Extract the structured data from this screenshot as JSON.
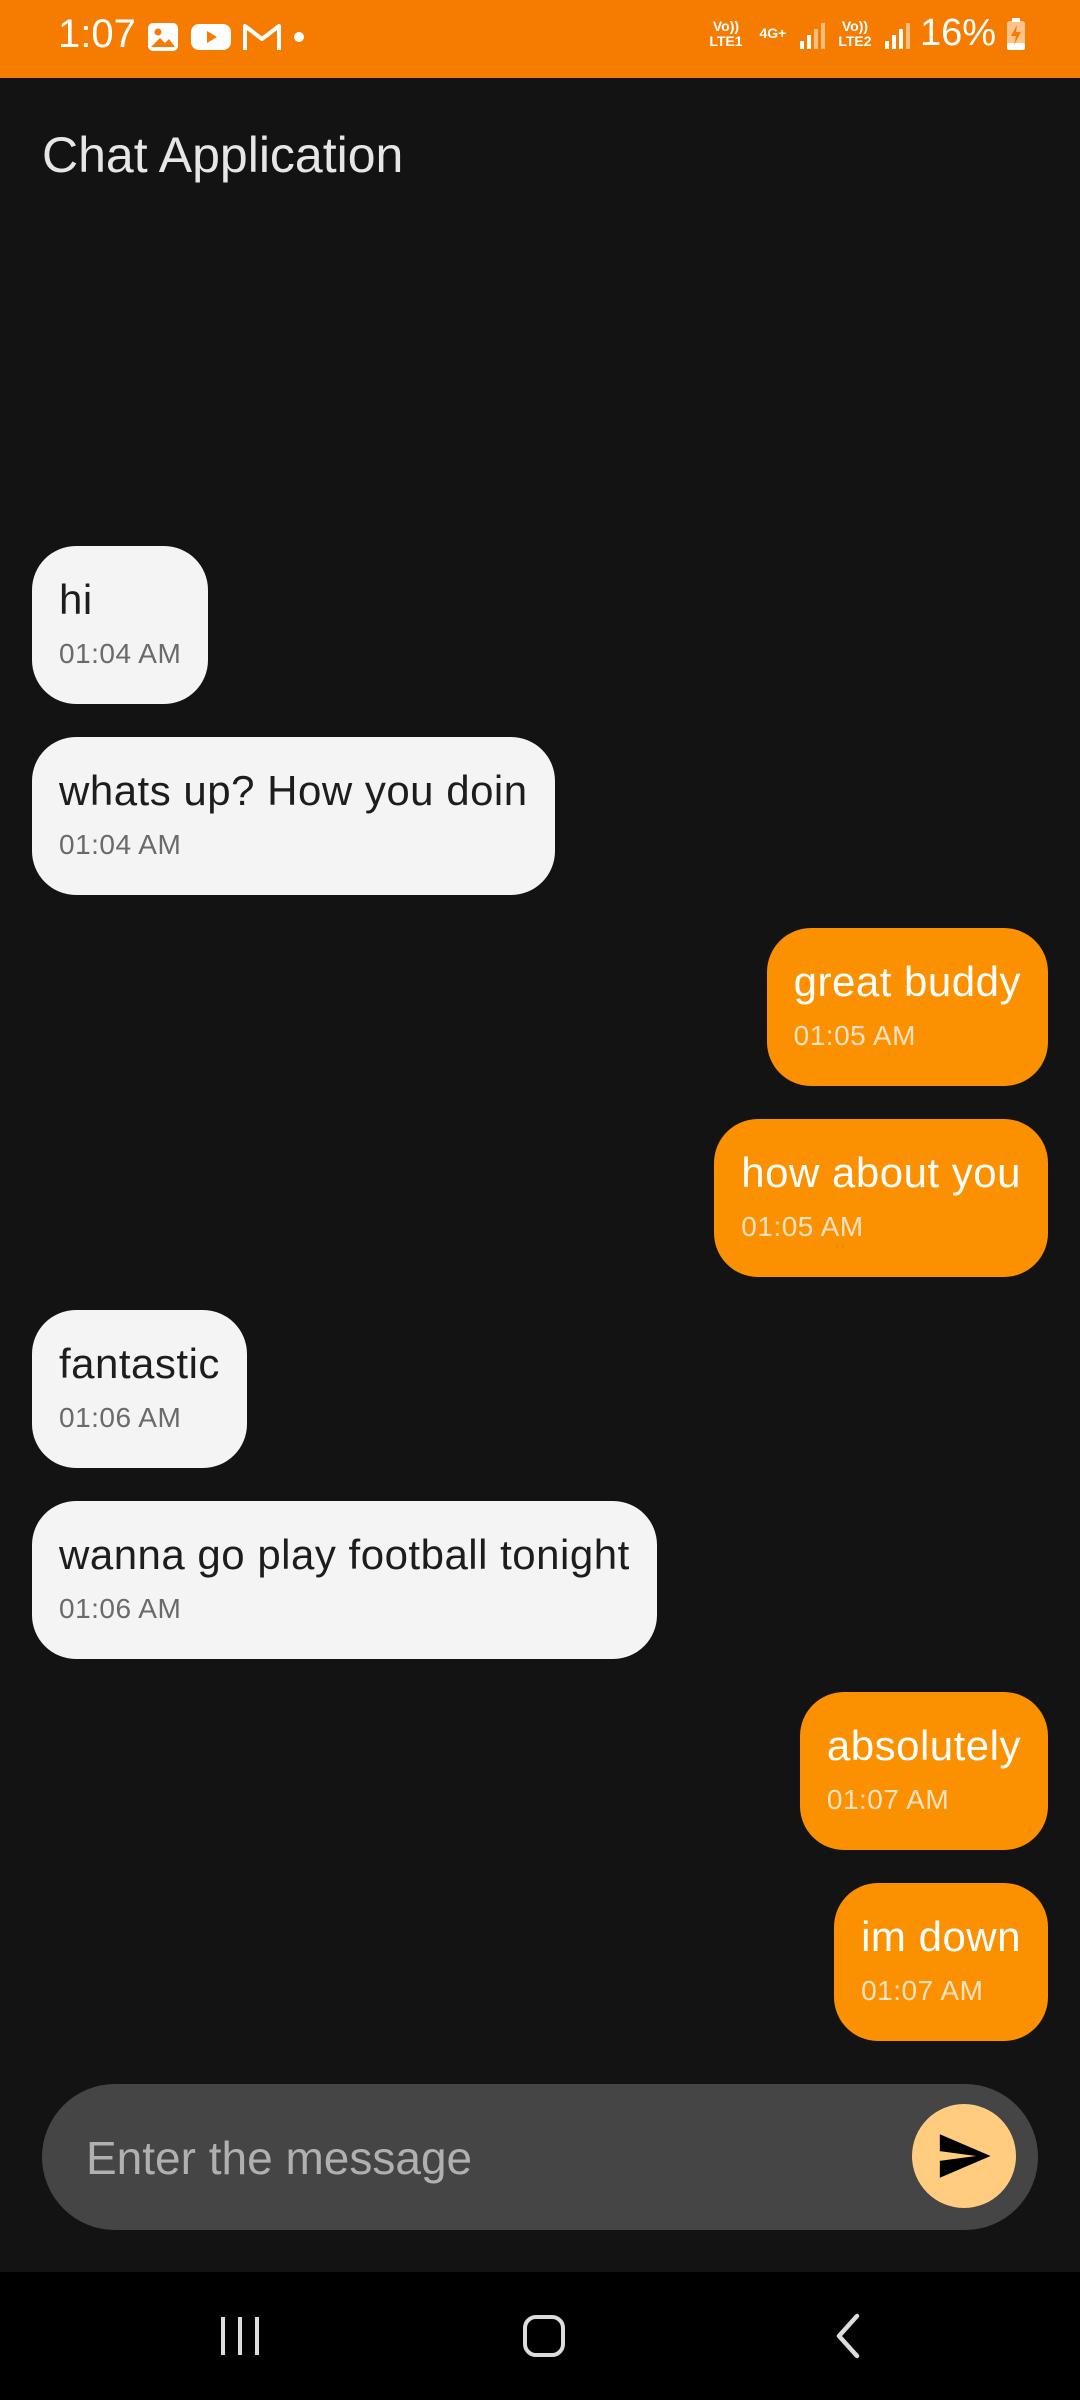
{
  "status_bar": {
    "time": "1:07",
    "net1": "Vo)) LTE1",
    "net_type": "4G+",
    "net2": "Vo)) LTE2",
    "battery": "16%"
  },
  "app": {
    "title": "Chat Application"
  },
  "messages": [
    {
      "text": "hi",
      "time": "01:04 AM",
      "direction": "received"
    },
    {
      "text": "whats up? How you doin",
      "time": "01:04 AM",
      "direction": "received"
    },
    {
      "text": "great buddy",
      "time": "01:05 AM",
      "direction": "sent"
    },
    {
      "text": "how about you",
      "time": "01:05 AM",
      "direction": "sent"
    },
    {
      "text": "fantastic",
      "time": "01:06 AM",
      "direction": "received"
    },
    {
      "text": "wanna go play football tonight",
      "time": "01:06 AM",
      "direction": "received"
    },
    {
      "text": "absolutely",
      "time": "01:07 AM",
      "direction": "sent"
    },
    {
      "text": "im down",
      "time": "01:07 AM",
      "direction": "sent"
    }
  ],
  "composer": {
    "placeholder": "Enter the message",
    "value": ""
  },
  "colors": {
    "accent": "#f57c00",
    "sent_bubble": "#fb9100",
    "received_bubble": "#f4f4f4",
    "background": "#131313",
    "send_button": "#ffcc80"
  },
  "icons": {
    "send": "send-icon",
    "recents": "recents-icon",
    "home": "home-icon",
    "back": "back-icon"
  }
}
